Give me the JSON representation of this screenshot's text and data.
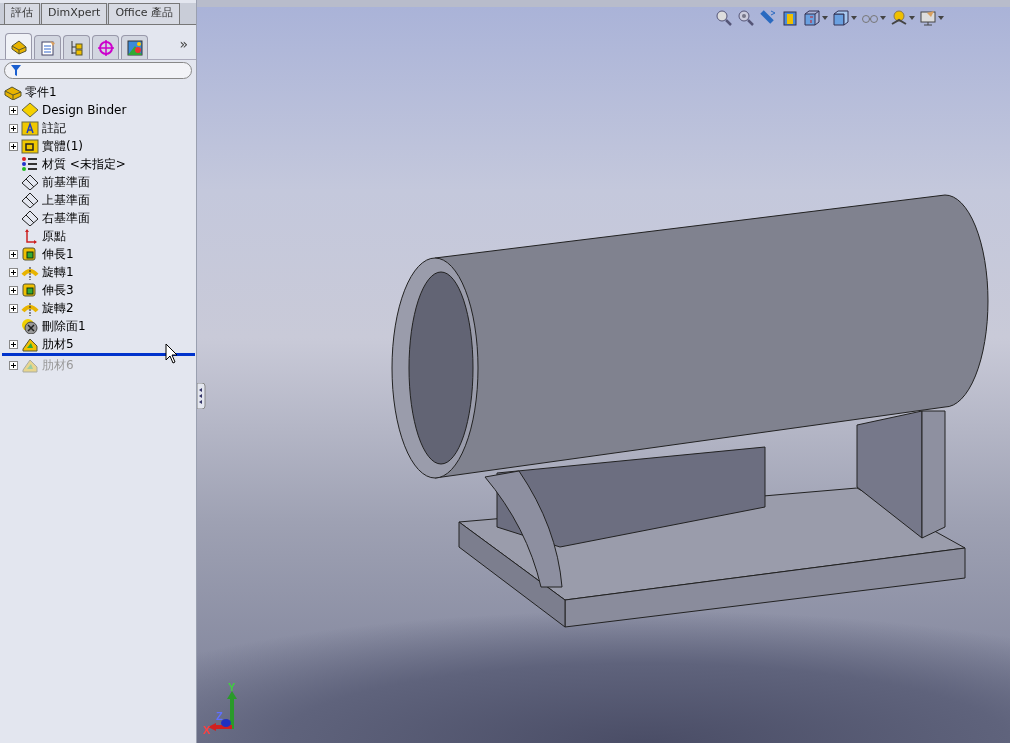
{
  "top_tabs": [
    {
      "label": "評估"
    },
    {
      "label": "DimXpert"
    },
    {
      "label": "Office 產品"
    }
  ],
  "panel_tabs": [
    {
      "kind": "feature",
      "selected": true
    },
    {
      "kind": "property",
      "selected": false
    },
    {
      "kind": "config",
      "selected": false
    },
    {
      "kind": "dimxpert",
      "selected": false
    },
    {
      "kind": "display",
      "selected": false
    }
  ],
  "panel_more": "»",
  "tree": {
    "root": {
      "label": "零件1",
      "kind": "part"
    },
    "items": [
      {
        "label": "Design Binder",
        "kind": "binder",
        "expandable": true,
        "suppressed": false,
        "rollback_below": false
      },
      {
        "label": "註記",
        "kind": "annotation",
        "expandable": true,
        "suppressed": false,
        "rollback_below": false
      },
      {
        "label": "實體(1)",
        "kind": "body",
        "expandable": true,
        "suppressed": false,
        "rollback_below": false
      },
      {
        "label": "材質 <未指定>",
        "kind": "material",
        "expandable": false,
        "suppressed": false,
        "rollback_below": false
      },
      {
        "label": "前基準面",
        "kind": "plane",
        "expandable": false,
        "suppressed": false,
        "rollback_below": false
      },
      {
        "label": "上基準面",
        "kind": "plane",
        "expandable": false,
        "suppressed": false,
        "rollback_below": false
      },
      {
        "label": "右基準面",
        "kind": "plane",
        "expandable": false,
        "suppressed": false,
        "rollback_below": false
      },
      {
        "label": "原點",
        "kind": "origin",
        "expandable": false,
        "suppressed": false,
        "rollback_below": false
      },
      {
        "label": "伸長1",
        "kind": "extrude",
        "expandable": true,
        "suppressed": false,
        "rollback_below": false
      },
      {
        "label": "旋轉1",
        "kind": "revolve",
        "expandable": true,
        "suppressed": false,
        "rollback_below": false
      },
      {
        "label": "伸長3",
        "kind": "extrude",
        "expandable": true,
        "suppressed": false,
        "rollback_below": false
      },
      {
        "label": "旋轉2",
        "kind": "revolve",
        "expandable": true,
        "suppressed": false,
        "rollback_below": false
      },
      {
        "label": "刪除面1",
        "kind": "deleteface",
        "expandable": false,
        "suppressed": false,
        "rollback_below": false
      },
      {
        "label": "肋材5",
        "kind": "rib",
        "expandable": true,
        "suppressed": false,
        "rollback_below": true
      },
      {
        "label": "肋材6",
        "kind": "rib",
        "expandable": true,
        "suppressed": true,
        "rollback_below": false
      }
    ]
  },
  "view_toolbar": [
    {
      "kind": "zoom-fit",
      "menu": false
    },
    {
      "kind": "zoom-area",
      "menu": false
    },
    {
      "kind": "previous",
      "menu": false
    },
    {
      "kind": "section",
      "menu": false
    },
    {
      "kind": "orientation",
      "menu": true
    },
    {
      "kind": "display-style",
      "menu": true
    },
    {
      "kind": "hide-show",
      "menu": true
    },
    {
      "kind": "scene",
      "menu": true
    },
    {
      "kind": "view-settings",
      "menu": true
    }
  ],
  "triad": {
    "x": "X",
    "y": "Y",
    "z": "Z"
  }
}
